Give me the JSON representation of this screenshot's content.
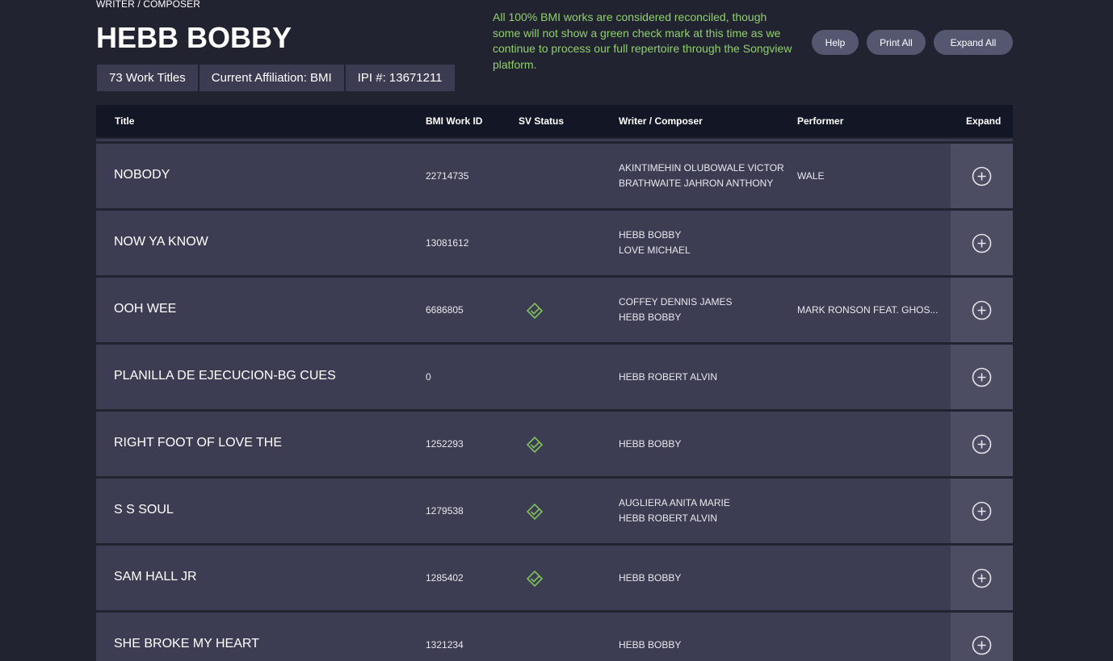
{
  "header": {
    "breadcrumb": "WRITER / COMPOSER",
    "name": "HEBB BOBBY",
    "stats": {
      "work_titles": "73 Work Titles",
      "affiliation": "Current Affiliation: BMI",
      "ipi": "IPI #: 13671211"
    },
    "notice": "All 100% BMI works are considered reconciled, though some will not show a green check mark at this time as we continue to process our full repertoire through the Songview platform.",
    "buttons": {
      "help": "Help",
      "print_all": "Print All",
      "expand_all": "Expand All"
    }
  },
  "table": {
    "columns": {
      "title": "Title",
      "work_id": "BMI Work ID",
      "sv_status": "SV Status",
      "writer": "Writer / Composer",
      "performer": "Performer",
      "expand": "Expand"
    },
    "rows": [
      {
        "title": "NOBODY",
        "work_id": "22714735",
        "reconciled": false,
        "writers": [
          "AKINTIMEHIN OLUBOWALE VICTOR",
          "BRATHWAITE JAHRON ANTHONY"
        ],
        "performer": "WALE"
      },
      {
        "title": "NOW YA KNOW",
        "work_id": "13081612",
        "reconciled": false,
        "writers": [
          "HEBB BOBBY",
          "LOVE MICHAEL"
        ],
        "performer": ""
      },
      {
        "title": "OOH WEE",
        "work_id": "6686805",
        "reconciled": true,
        "writers": [
          "COFFEY DENNIS JAMES",
          "HEBB BOBBY"
        ],
        "performer": "MARK RONSON FEAT. GHOS..."
      },
      {
        "title": "PLANILLA DE EJECUCION-BG CUES",
        "work_id": "0",
        "reconciled": false,
        "writers": [
          "HEBB ROBERT ALVIN"
        ],
        "performer": ""
      },
      {
        "title": "RIGHT FOOT OF LOVE THE",
        "work_id": "1252293",
        "reconciled": true,
        "writers": [
          "HEBB BOBBY"
        ],
        "performer": ""
      },
      {
        "title": "S S SOUL",
        "work_id": "1279538",
        "reconciled": true,
        "writers": [
          "AUGLIERA ANITA MARIE",
          "HEBB ROBERT ALVIN"
        ],
        "performer": ""
      },
      {
        "title": "SAM HALL JR",
        "work_id": "1285402",
        "reconciled": true,
        "writers": [
          "HEBB BOBBY"
        ],
        "performer": ""
      },
      {
        "title": "SHE BROKE MY HEART",
        "work_id": "1321234",
        "reconciled": false,
        "writers": [
          "HEBB BOBBY"
        ],
        "performer": ""
      }
    ]
  },
  "colors": {
    "background": "#222331",
    "row": "#3c3d52",
    "expand_cell": "#4c4d63",
    "notice_green": "#8fd06b",
    "check_green": "#7fc15a"
  }
}
